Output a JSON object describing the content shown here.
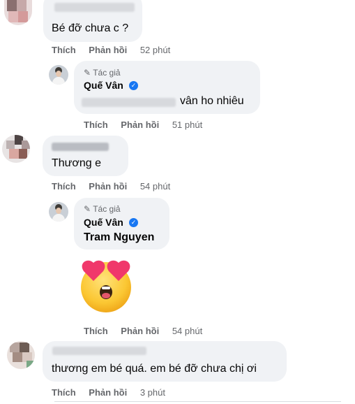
{
  "labels": {
    "like": "Thích",
    "reply": "Phản hồi",
    "author_badge": "Tác giả"
  },
  "author": {
    "name": "Quế Vân"
  },
  "comments": [
    {
      "text": "Bé đỡ chưa c ?",
      "time": "52 phút"
    },
    {
      "text_visible": "vân ho nhiêu",
      "time": "51 phút"
    },
    {
      "text": "Thương e",
      "time": "54 phút"
    },
    {
      "mention": "Tram Nguyen",
      "emoji": "heart-eyes",
      "time": "54 phút"
    },
    {
      "text": "thương em bé quá. em bé đỡ chưa chị ơi",
      "time": "3 phút"
    }
  ],
  "colors": {
    "bubble": "#f0f2f5",
    "muted": "#65676b",
    "verified": "#1877f2"
  }
}
